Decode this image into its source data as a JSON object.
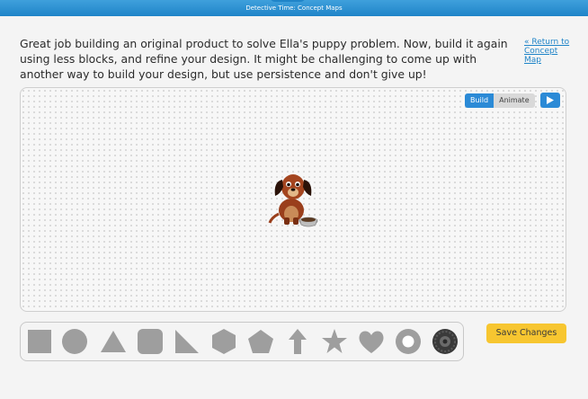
{
  "header": {
    "title": "Detective Time: Concept Maps"
  },
  "instructions": {
    "text": "Great job building an original product to solve Ella's puppy problem. Now, build it again using less blocks, and refine your design. It might be challenging to come up with another way to build your design, but use persistence and don't give up!"
  },
  "nav": {
    "return_link": "« Return to Concept Map"
  },
  "canvas": {
    "mode_build": "Build",
    "mode_animate": "Animate",
    "active_mode": "Build",
    "play_icon": "play-icon",
    "character_icon": "puppy-icon"
  },
  "shape_tray": {
    "shapes": [
      "square",
      "circle",
      "triangle",
      "rounded-square",
      "right-triangle",
      "hexagon",
      "pentagon",
      "arrow-up",
      "star",
      "heart",
      "ring",
      "tire"
    ]
  },
  "actions": {
    "save_label": "Save Changes"
  },
  "colors": {
    "header_blue": "#1f84c8",
    "button_blue": "#2b8ad6",
    "save_yellow": "#f7c630",
    "shape_gray": "#9e9e9e"
  }
}
